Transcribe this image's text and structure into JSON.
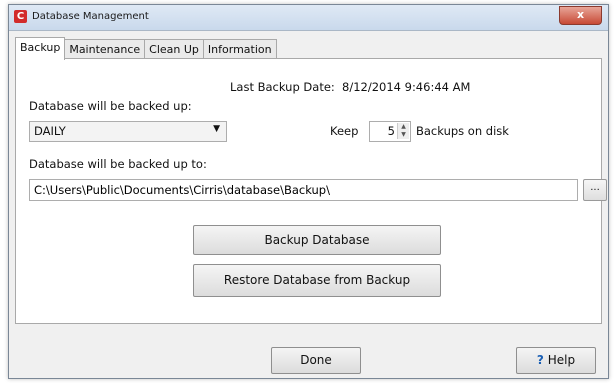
{
  "window": {
    "title": "Database Management",
    "app_icon_glyph": "C",
    "close_glyph": "x"
  },
  "tabs": [
    {
      "label": "Backup",
      "active": true
    },
    {
      "label": "Maintenance",
      "active": false
    },
    {
      "label": "Clean Up",
      "active": false
    },
    {
      "label": "Information",
      "active": false
    }
  ],
  "backup": {
    "last_backup_label": "Last Backup Date:",
    "last_backup_value": "8/12/2014 9:46:44 AM",
    "schedule_label": "Database will be backed up:",
    "schedule_value": "DAILY",
    "keep_label": "Keep",
    "keep_value": "5",
    "keep_suffix": "Backups on disk",
    "path_label": "Database will be backed up to:",
    "path_value": "C:\\Users\\Public\\Documents\\Cirris\\database\\Backup\\",
    "browse_label": "...",
    "backup_button": "Backup Database",
    "restore_button": "Restore Database from Backup"
  },
  "footer": {
    "done_button": "Done",
    "help_button": "Help",
    "help_icon_glyph": "?"
  },
  "colors": {
    "help_icon": "#1a5fb4",
    "close_button": "#c74a36"
  }
}
